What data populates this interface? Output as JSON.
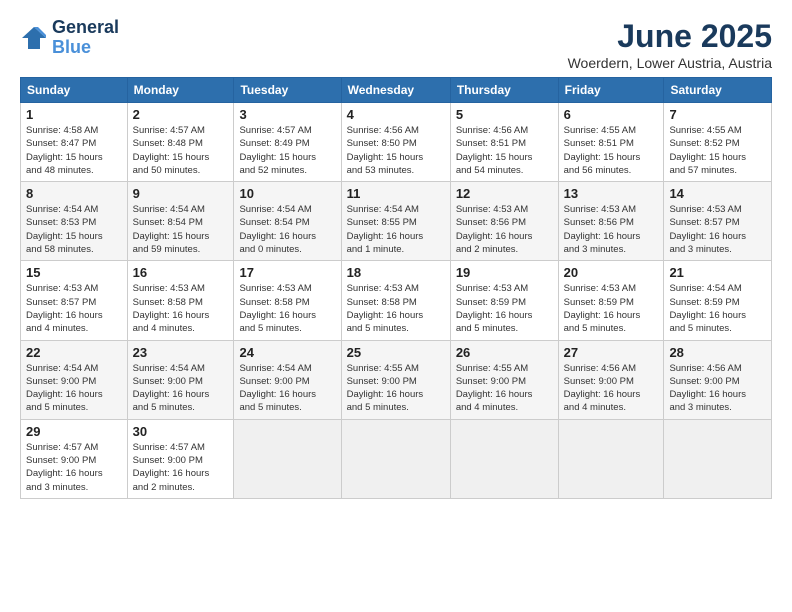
{
  "header": {
    "logo_line1": "General",
    "logo_line2": "Blue",
    "month": "June 2025",
    "location": "Woerdern, Lower Austria, Austria"
  },
  "days_of_week": [
    "Sunday",
    "Monday",
    "Tuesday",
    "Wednesday",
    "Thursday",
    "Friday",
    "Saturday"
  ],
  "weeks": [
    [
      {
        "day": "1",
        "info": "Sunrise: 4:58 AM\nSunset: 8:47 PM\nDaylight: 15 hours\nand 48 minutes."
      },
      {
        "day": "2",
        "info": "Sunrise: 4:57 AM\nSunset: 8:48 PM\nDaylight: 15 hours\nand 50 minutes."
      },
      {
        "day": "3",
        "info": "Sunrise: 4:57 AM\nSunset: 8:49 PM\nDaylight: 15 hours\nand 52 minutes."
      },
      {
        "day": "4",
        "info": "Sunrise: 4:56 AM\nSunset: 8:50 PM\nDaylight: 15 hours\nand 53 minutes."
      },
      {
        "day": "5",
        "info": "Sunrise: 4:56 AM\nSunset: 8:51 PM\nDaylight: 15 hours\nand 54 minutes."
      },
      {
        "day": "6",
        "info": "Sunrise: 4:55 AM\nSunset: 8:51 PM\nDaylight: 15 hours\nand 56 minutes."
      },
      {
        "day": "7",
        "info": "Sunrise: 4:55 AM\nSunset: 8:52 PM\nDaylight: 15 hours\nand 57 minutes."
      }
    ],
    [
      {
        "day": "8",
        "info": "Sunrise: 4:54 AM\nSunset: 8:53 PM\nDaylight: 15 hours\nand 58 minutes."
      },
      {
        "day": "9",
        "info": "Sunrise: 4:54 AM\nSunset: 8:54 PM\nDaylight: 15 hours\nand 59 minutes."
      },
      {
        "day": "10",
        "info": "Sunrise: 4:54 AM\nSunset: 8:54 PM\nDaylight: 16 hours\nand 0 minutes."
      },
      {
        "day": "11",
        "info": "Sunrise: 4:54 AM\nSunset: 8:55 PM\nDaylight: 16 hours\nand 1 minute."
      },
      {
        "day": "12",
        "info": "Sunrise: 4:53 AM\nSunset: 8:56 PM\nDaylight: 16 hours\nand 2 minutes."
      },
      {
        "day": "13",
        "info": "Sunrise: 4:53 AM\nSunset: 8:56 PM\nDaylight: 16 hours\nand 3 minutes."
      },
      {
        "day": "14",
        "info": "Sunrise: 4:53 AM\nSunset: 8:57 PM\nDaylight: 16 hours\nand 3 minutes."
      }
    ],
    [
      {
        "day": "15",
        "info": "Sunrise: 4:53 AM\nSunset: 8:57 PM\nDaylight: 16 hours\nand 4 minutes."
      },
      {
        "day": "16",
        "info": "Sunrise: 4:53 AM\nSunset: 8:58 PM\nDaylight: 16 hours\nand 4 minutes."
      },
      {
        "day": "17",
        "info": "Sunrise: 4:53 AM\nSunset: 8:58 PM\nDaylight: 16 hours\nand 5 minutes."
      },
      {
        "day": "18",
        "info": "Sunrise: 4:53 AM\nSunset: 8:58 PM\nDaylight: 16 hours\nand 5 minutes."
      },
      {
        "day": "19",
        "info": "Sunrise: 4:53 AM\nSunset: 8:59 PM\nDaylight: 16 hours\nand 5 minutes."
      },
      {
        "day": "20",
        "info": "Sunrise: 4:53 AM\nSunset: 8:59 PM\nDaylight: 16 hours\nand 5 minutes."
      },
      {
        "day": "21",
        "info": "Sunrise: 4:54 AM\nSunset: 8:59 PM\nDaylight: 16 hours\nand 5 minutes."
      }
    ],
    [
      {
        "day": "22",
        "info": "Sunrise: 4:54 AM\nSunset: 9:00 PM\nDaylight: 16 hours\nand 5 minutes."
      },
      {
        "day": "23",
        "info": "Sunrise: 4:54 AM\nSunset: 9:00 PM\nDaylight: 16 hours\nand 5 minutes."
      },
      {
        "day": "24",
        "info": "Sunrise: 4:54 AM\nSunset: 9:00 PM\nDaylight: 16 hours\nand 5 minutes."
      },
      {
        "day": "25",
        "info": "Sunrise: 4:55 AM\nSunset: 9:00 PM\nDaylight: 16 hours\nand 5 minutes."
      },
      {
        "day": "26",
        "info": "Sunrise: 4:55 AM\nSunset: 9:00 PM\nDaylight: 16 hours\nand 4 minutes."
      },
      {
        "day": "27",
        "info": "Sunrise: 4:56 AM\nSunset: 9:00 PM\nDaylight: 16 hours\nand 4 minutes."
      },
      {
        "day": "28",
        "info": "Sunrise: 4:56 AM\nSunset: 9:00 PM\nDaylight: 16 hours\nand 3 minutes."
      }
    ],
    [
      {
        "day": "29",
        "info": "Sunrise: 4:57 AM\nSunset: 9:00 PM\nDaylight: 16 hours\nand 3 minutes."
      },
      {
        "day": "30",
        "info": "Sunrise: 4:57 AM\nSunset: 9:00 PM\nDaylight: 16 hours\nand 2 minutes."
      },
      {
        "day": "",
        "info": ""
      },
      {
        "day": "",
        "info": ""
      },
      {
        "day": "",
        "info": ""
      },
      {
        "day": "",
        "info": ""
      },
      {
        "day": "",
        "info": ""
      }
    ]
  ]
}
